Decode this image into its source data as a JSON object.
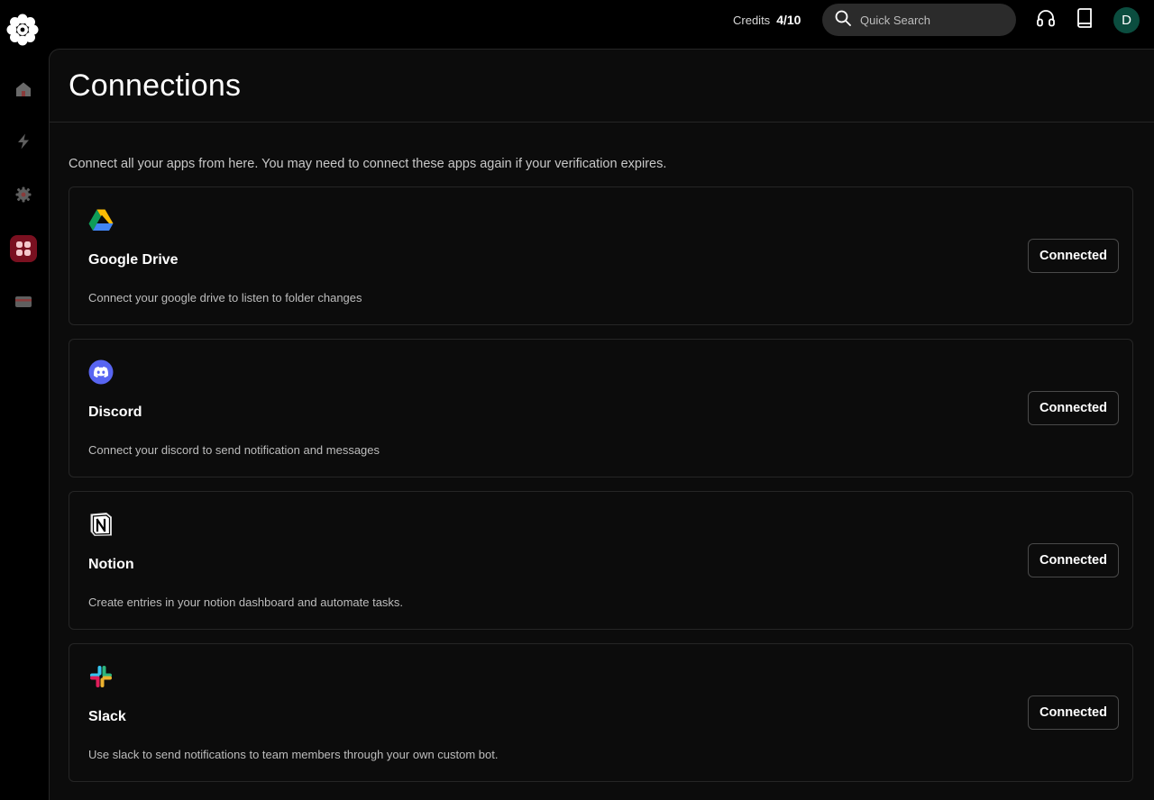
{
  "sidebar": {
    "logo": "flower-logo-icon",
    "items": [
      {
        "icon": "home-icon",
        "active": false
      },
      {
        "icon": "lightning-icon",
        "active": false
      },
      {
        "icon": "settings-gear-icon",
        "active": false
      },
      {
        "icon": "apps-grid-icon",
        "active": true
      },
      {
        "icon": "credit-card-icon",
        "active": false
      }
    ]
  },
  "topbar": {
    "credits_label": "Credits",
    "credits_value": "4/10",
    "search_placeholder": "Quick Search",
    "avatar_initial": "D"
  },
  "page": {
    "title": "Connections",
    "intro": "Connect all your apps from here. You may need to connect these apps again if your verification expires."
  },
  "connections": [
    {
      "icon": "google-drive-icon",
      "name": "Google Drive",
      "description": "Connect your google drive to listen to folder changes",
      "button": "Connected"
    },
    {
      "icon": "discord-icon",
      "name": "Discord",
      "description": "Connect your discord to send notification and messages",
      "button": "Connected"
    },
    {
      "icon": "notion-icon",
      "name": "Notion",
      "description": "Create entries in your notion dashboard and automate tasks.",
      "button": "Connected"
    },
    {
      "icon": "slack-icon",
      "name": "Slack",
      "description": "Use slack to send notifications to team members through your own custom bot.",
      "button": "Connected"
    }
  ],
  "colors": {
    "background": "#000000",
    "panel": "#0c0c0c",
    "active_nav": "#7a1020",
    "avatar": "#0b4d3f",
    "discord": "#5865f2"
  }
}
